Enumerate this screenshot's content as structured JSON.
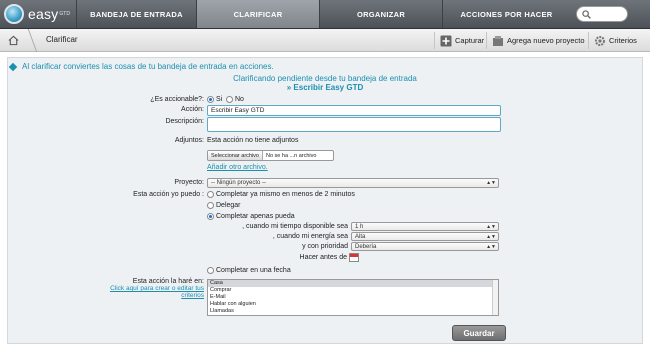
{
  "app": {
    "logo_text": "easy",
    "logo_sup": "GTD"
  },
  "nav": {
    "tabs": [
      {
        "label": "BANDEJA DE ENTRADA"
      },
      {
        "label": "CLARIFICAR"
      },
      {
        "label": "ORGANIZAR"
      },
      {
        "label": "ACCIONES POR HACER"
      }
    ]
  },
  "toolbar": {
    "breadcrumb": "Clarificar",
    "capturar": "Capturar",
    "add_project": "Agrega nuevo proyecto",
    "criterios": "Criterios"
  },
  "info": "Al clarificar conviertes las cosas de tu bandeja de entrada en acciones.",
  "heading": {
    "line1": "Clarificando pendiente desde tu bandeja de entrada",
    "line2": "» Escribir Easy GTD"
  },
  "form": {
    "accionable_label": "¿Es accionable?:",
    "si": "Si",
    "no": "No",
    "accion_label": "Acción:",
    "accion_value": "Escribir Easy GTD",
    "descripcion_label": "Descripción:",
    "adjuntos_label": "Adjuntos:",
    "adjuntos_value": "Esta acción no tiene adjuntos",
    "file_button": "Seleccionar archivo",
    "file_name": "No se ha ...n archivo",
    "add_file": "Añadir otro archivo.",
    "proyecto_label": "Proyecto:",
    "proyecto_value": "-- Ningún proyecto --",
    "puedo_label": "Esta acción yo puedo :",
    "opt_2min": "Completar ya mismo en menos de 2 minutos",
    "opt_delegar": "Delegar",
    "opt_apenas": "Completar apenas pueda",
    "tiempo_label": ", cuando mi tiempo disponible sea",
    "tiempo_value": "1 h",
    "energia_label": ", cuando mi energía sea",
    "energia_value": "Alta",
    "prioridad_label": "y con prioridad",
    "prioridad_value": "Debería",
    "hacer_antes": "Hacer antes de",
    "opt_fecha": "Completar en una fecha",
    "hare_en_label": "Esta acción la haré en:",
    "criterios_link": "Click aquí para crear o editar tus criterios",
    "contexts": [
      "Casa",
      "Comprar",
      "E-Mail",
      "Hablar con alguien",
      "Llamadas"
    ],
    "guardar": "Guardar"
  }
}
